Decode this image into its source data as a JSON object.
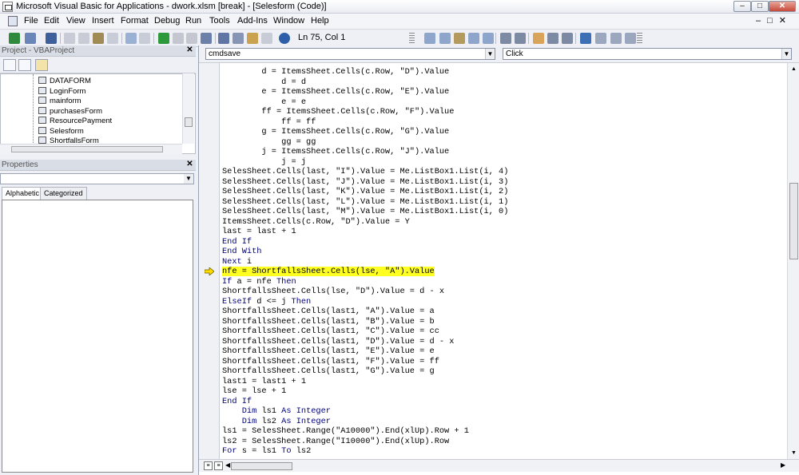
{
  "window": {
    "title": "Microsoft Visual Basic for Applications - dwork.xlsm [break] - [Selesform (Code)]",
    "minimize_label": "–",
    "maximize_label": "□",
    "close_label": "✕"
  },
  "menu": {
    "items": [
      "File",
      "Edit",
      "View",
      "Insert",
      "Format",
      "Debug",
      "Run",
      "Tools",
      "Add-Ins",
      "Window",
      "Help"
    ],
    "right_controls": "–□✕"
  },
  "toolbar": {
    "position_text": "Ln 75, Col 1"
  },
  "project": {
    "title": "Project - VBAProject",
    "close_label": "✕",
    "items": [
      "DATAFORM",
      "LoginForm",
      "mainform",
      "purchasesForm",
      "ResourcePayment",
      "Selesform",
      "ShortfallsForm"
    ]
  },
  "properties": {
    "title": "Properties",
    "close_label": "✕",
    "tabs": [
      "Alphabetic",
      "Categorized"
    ]
  },
  "code": {
    "object_selector": "cmdsave",
    "procedure_selector": "Click",
    "current_line_index": 20,
    "lines": [
      "        d = ItemsSheet.Cells(c.Row, \"D\").Value",
      "            d = d",
      "        e = ItemsSheet.Cells(c.Row, \"E\").Value",
      "            e = e",
      "        ff = ItemsSheet.Cells(c.Row, \"F\").Value",
      "            ff = ff",
      "        g = ItemsSheet.Cells(c.Row, \"G\").Value",
      "            gg = gg",
      "        j = ItemsSheet.Cells(c.Row, \"J\").Value",
      "            j = j",
      "SelesSheet.Cells(last, \"I\").Value = Me.ListBox1.List(i, 4)",
      "SelesSheet.Cells(last, \"J\").Value = Me.ListBox1.List(i, 3)",
      "SelesSheet.Cells(last, \"K\").Value = Me.ListBox1.List(i, 2)",
      "SelesSheet.Cells(last, \"L\").Value = Me.ListBox1.List(i, 1)",
      "SelesSheet.Cells(last, \"M\").Value = Me.ListBox1.List(i, 0)",
      "ItemsSheet.Cells(c.Row, \"D\").Value = Y",
      "last = last + 1",
      "End If",
      "End With",
      "Next i",
      "nfe = ShortfallsSheet.Cells(lse, \"A\").Value",
      "If a = nfe Then",
      "ShortfallsSheet.Cells(lse, \"D\").Value = d - x",
      "ElseIf d <= j Then",
      "ShortfallsSheet.Cells(last1, \"A\").Value = a",
      "ShortfallsSheet.Cells(last1, \"B\").Value = b",
      "ShortfallsSheet.Cells(last1, \"C\").Value = cc",
      "ShortfallsSheet.Cells(last1, \"D\").Value = d - x",
      "ShortfallsSheet.Cells(last1, \"E\").Value = e",
      "ShortfallsSheet.Cells(last1, \"F\").Value = ff",
      "ShortfallsSheet.Cells(last1, \"G\").Value = g",
      "last1 = last1 + 1",
      "lse = lse + 1",
      "End If",
      "    Dim ls1 As Integer",
      "    Dim ls2 As Integer",
      "ls1 = SelesSheet.Range(\"A10000\").End(xlUp).Row + 1",
      "ls2 = SelesSheet.Range(\"I10000\").End(xlUp).Row",
      "For s = ls1 To ls2"
    ]
  },
  "colors": {
    "keyword": "#00007f",
    "highlight": "#ffff22",
    "exec_arrow": "#ffdd00"
  }
}
